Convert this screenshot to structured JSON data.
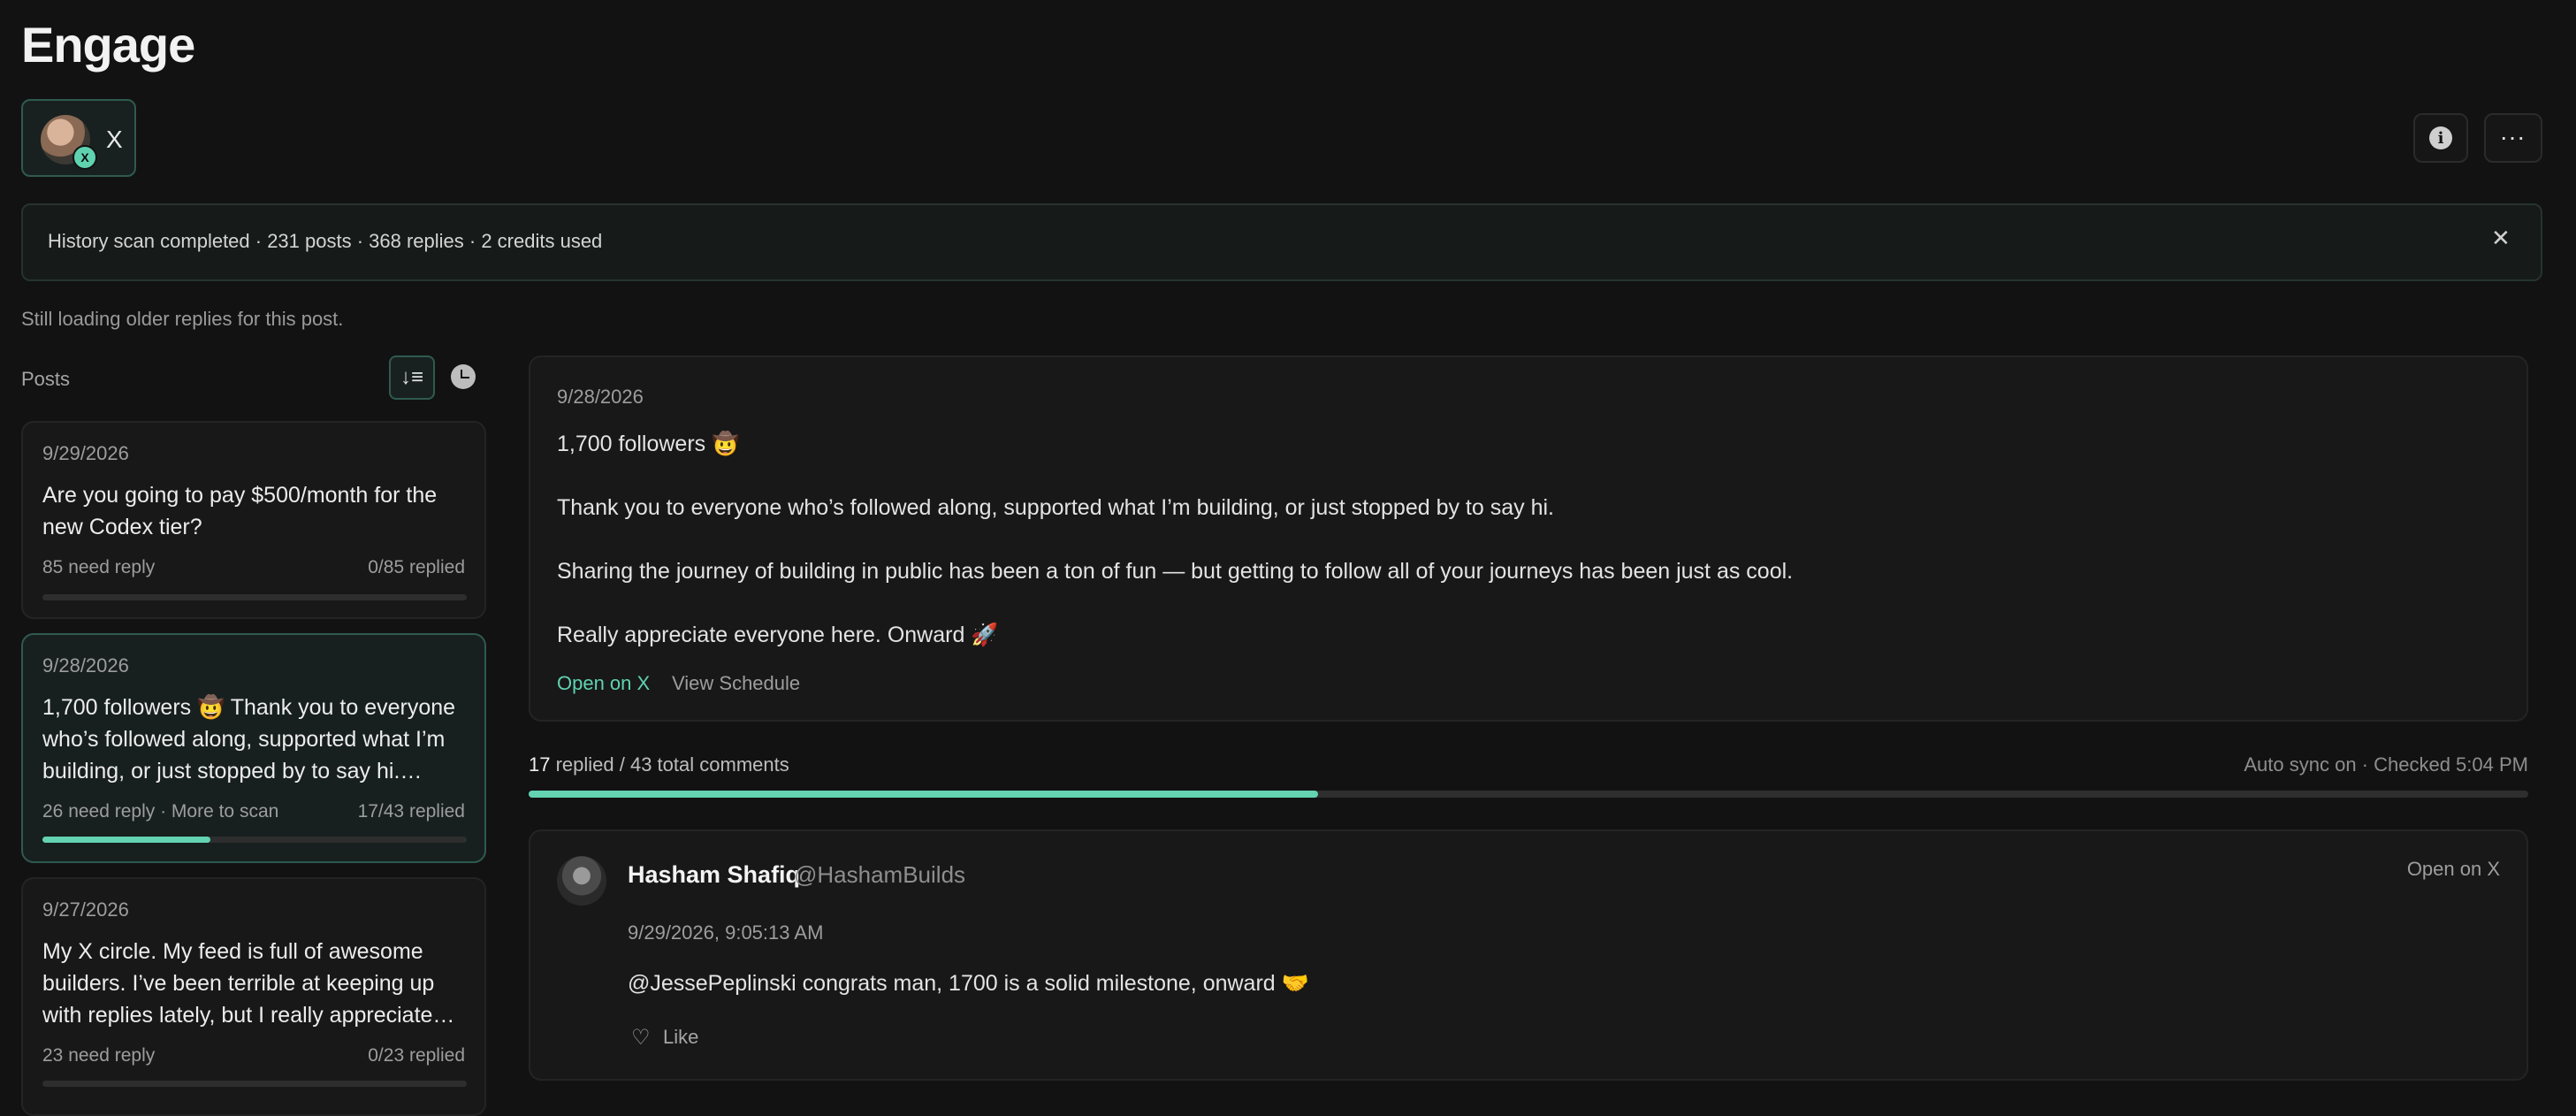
{
  "page": {
    "title": "Engage"
  },
  "account": {
    "platform_label": "X",
    "badge": "X"
  },
  "toolbar": {
    "info_icon": "info-icon",
    "more_icon": "more-icon"
  },
  "banner": {
    "text": "History scan completed · 231 posts · 368 replies · 2 credits used",
    "close": "✕"
  },
  "loading_note": "Still loading older replies for this post.",
  "posts_panel": {
    "label": "Posts",
    "sort_icon": "↓≡",
    "posts": [
      {
        "date": "9/29/2026",
        "text": "Are you going to pay $500/month for the new Codex tier?",
        "need": "85 need reply",
        "replied": "0/85 replied",
        "progress": 0
      },
      {
        "date": "9/28/2026",
        "text": "1,700 followers 🤠 Thank you to everyone who’s followed along, supported what I’m building, or just stopped by to say hi. Sharing the journey of building in public has been a ton of fun",
        "need": "26 need reply · More to scan",
        "replied": "17/43 replied",
        "progress": 0.395
      },
      {
        "date": "9/27/2026",
        "text": "My X circle. My feed is full of awesome builders. I’ve been terrible at keeping up with replies lately, but I really appreciate every one of you",
        "need": "23 need reply",
        "replied": "0/23 replied",
        "progress": 0
      }
    ]
  },
  "detail": {
    "date": "9/28/2026",
    "paragraphs": [
      "1,700 followers 🤠",
      "Thank you to everyone who’s followed along, supported what I’m building, or just stopped by to say hi.",
      "Sharing the journey of building in public has been a ton of fun — but getting to follow all of your journeys has been just as cool.",
      "Really appreciate everyone here. Onward 🚀"
    ],
    "open_link": "Open on X",
    "schedule_link": "View Schedule"
  },
  "progress": {
    "replied_count": "17",
    "summary_rest": " replied / 43 total comments",
    "sync": "Auto sync on · Checked 5:04 PM",
    "fraction": 0.395
  },
  "reply": {
    "name": "Hasham Shafiq",
    "handle": "@HashamBuilds",
    "open_link": "Open on X",
    "timestamp": "9/29/2026, 9:05:13 AM",
    "text": "@JessePeplinski congrats man, 1700 is a solid milestone, onward 🤝",
    "like_label": "Like",
    "like_icon": "♡"
  },
  "colors": {
    "accent": "#63d3b1",
    "background": "#121212",
    "card": "#181818"
  }
}
